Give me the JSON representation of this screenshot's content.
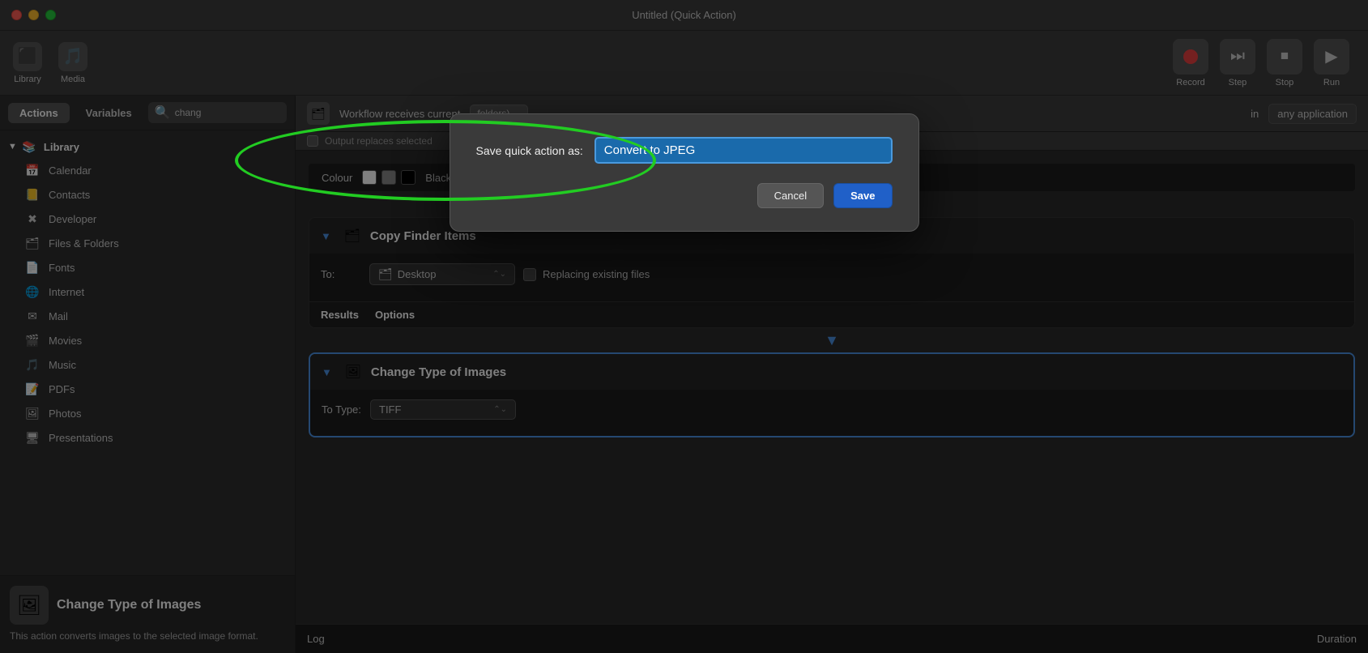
{
  "window": {
    "title": "Untitled (Quick Action)"
  },
  "toolbar": {
    "library_label": "Library",
    "media_label": "Media",
    "record_label": "Record",
    "step_label": "Step",
    "stop_label": "Stop",
    "run_label": "Run"
  },
  "sidebar": {
    "tab_actions": "Actions",
    "tab_variables": "Variables",
    "search_placeholder": "chang",
    "library_title": "Library",
    "items": [
      {
        "label": "Calendar",
        "icon": "📅"
      },
      {
        "label": "Contacts",
        "icon": "📒"
      },
      {
        "label": "Developer",
        "icon": "✖"
      },
      {
        "label": "Files & Folders",
        "icon": "🗂"
      },
      {
        "label": "Fonts",
        "icon": "📄"
      },
      {
        "label": "Internet",
        "icon": "🌐"
      },
      {
        "label": "Mail",
        "icon": "✉"
      },
      {
        "label": "Movies",
        "icon": "🎬"
      },
      {
        "label": "Music",
        "icon": "🎵"
      },
      {
        "label": "PDFs",
        "icon": "📝"
      },
      {
        "label": "Photos",
        "icon": "🖼"
      },
      {
        "label": "Presentations",
        "icon": "🖥"
      }
    ],
    "preview": {
      "icon": "🖼",
      "title": "Change Type of Images",
      "description": "This action converts images to the selected image format."
    }
  },
  "workflow": {
    "receive_label": "Workflow receives current",
    "folders_label": "folders)",
    "in_label": "in",
    "app_label": "any application",
    "output_label": "Output replaces selected",
    "color_label": "Colour",
    "color_value": "Black",
    "copy_finder_items": {
      "title": "Copy Finder Items",
      "to_label": "To:",
      "destination": "Desktop",
      "replacing_label": "Replacing existing files"
    },
    "change_type": {
      "title": "Change Type of Images",
      "to_type_label": "To Type:",
      "type_value": "TIFF"
    },
    "results_label": "Results",
    "options_label": "Options",
    "log_label": "Log",
    "duration_label": "Duration"
  },
  "modal": {
    "save_label": "Save quick action as:",
    "input_value": "Convert to JPEG",
    "cancel_label": "Cancel",
    "save_btn_label": "Save"
  }
}
